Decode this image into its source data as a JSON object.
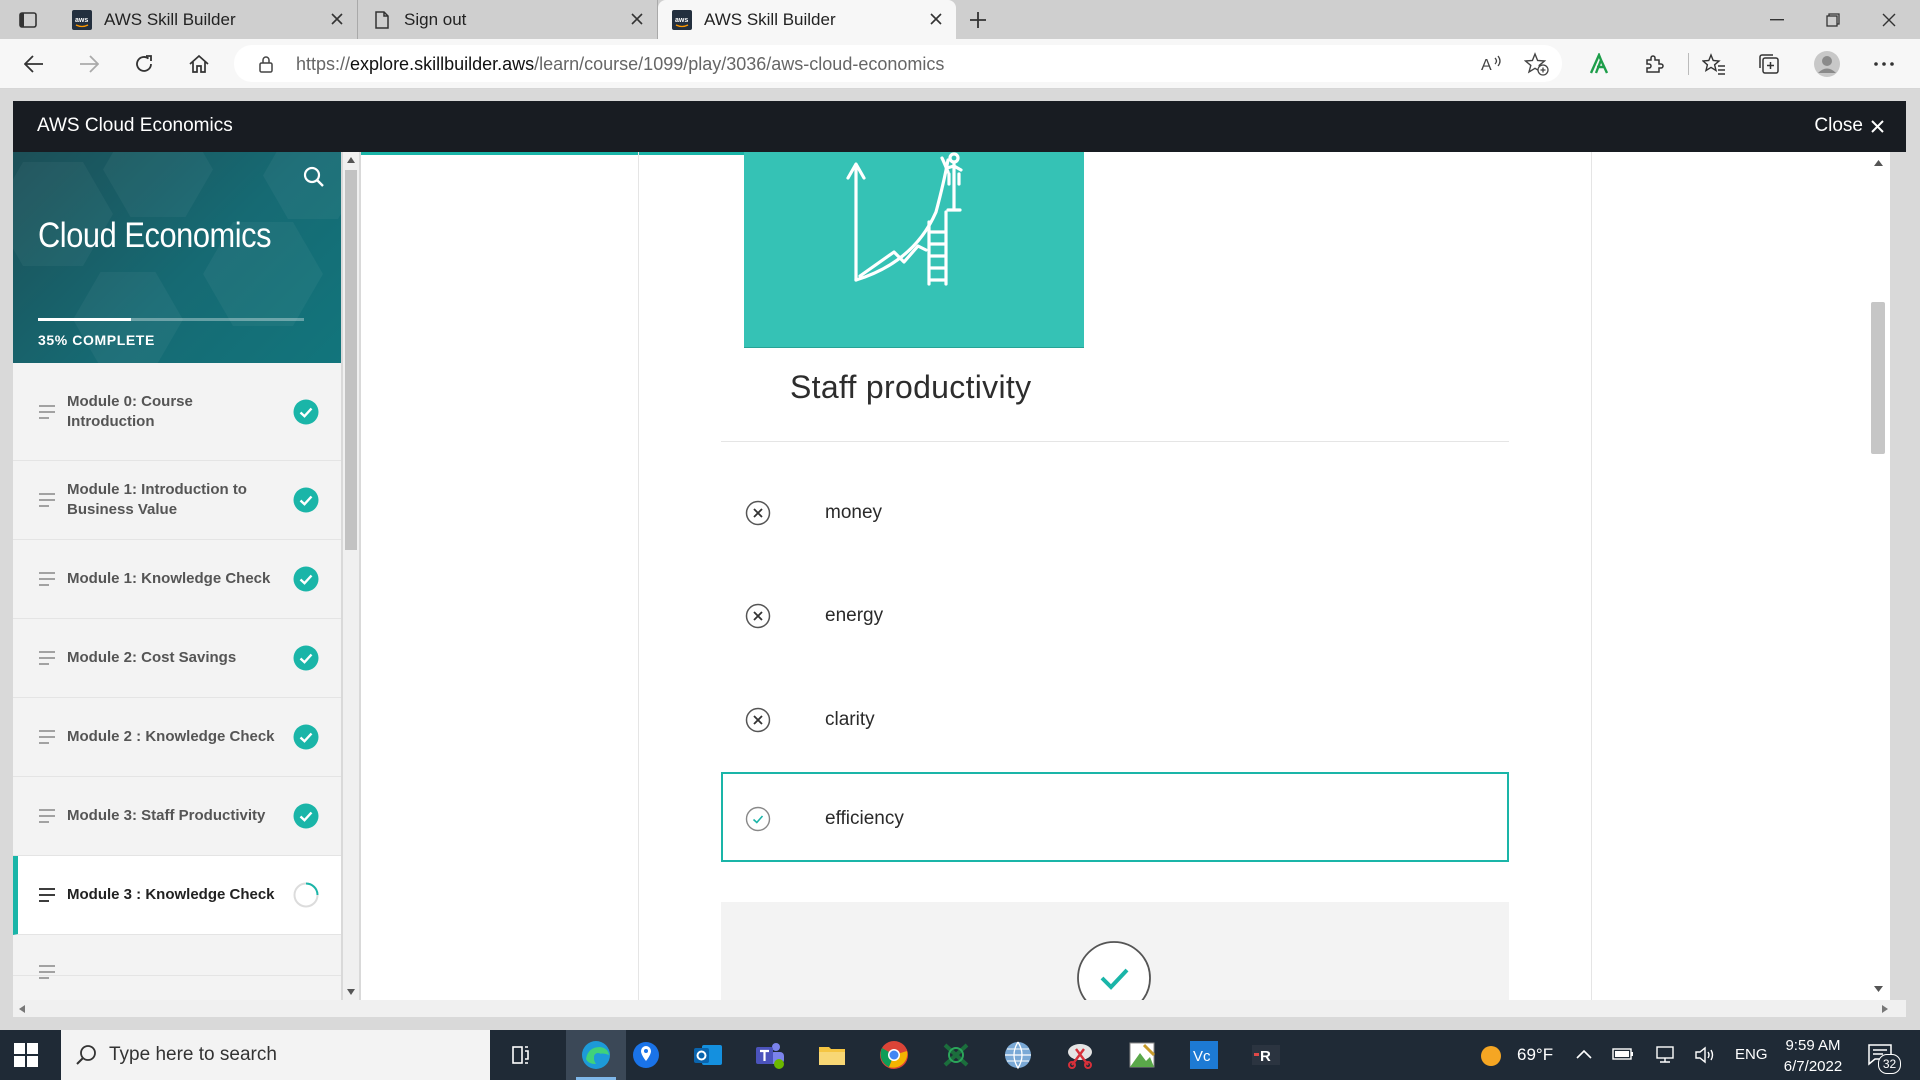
{
  "browser": {
    "tabs": [
      {
        "title": "AWS Skill Builder",
        "active": false
      },
      {
        "title": "Sign out",
        "active": false
      },
      {
        "title": "AWS Skill Builder",
        "active": true
      }
    ],
    "url_prefix": "https://",
    "url_host": "explore.skillbuilder.aws",
    "url_path": "/learn/course/1099/play/3036/aws-cloud-economics"
  },
  "course_bar": {
    "title": "AWS Cloud Economics",
    "close_label": "Close"
  },
  "sidebar": {
    "course_name": "Cloud Economics",
    "progress_fraction": 0.35,
    "progress_label": "35% COMPLETE",
    "modules": [
      {
        "label": "Module 0: Course Introduction",
        "status": "complete"
      },
      {
        "label": "Module 1: Introduction to Business Value",
        "status": "complete"
      },
      {
        "label": "Module 1: Knowledge Check",
        "status": "complete"
      },
      {
        "label": "Module 2: Cost Savings",
        "status": "complete"
      },
      {
        "label": "Module 2 : Knowledge Check",
        "status": "complete"
      },
      {
        "label": "Module 3: Staff Productivity",
        "status": "complete"
      },
      {
        "label": "Module 3 : Knowledge Check",
        "status": "in-progress"
      }
    ]
  },
  "content": {
    "card_label": "Staff productivity",
    "options": [
      {
        "text": "money",
        "result": "incorrect"
      },
      {
        "text": "energy",
        "result": "incorrect"
      },
      {
        "text": "clarity",
        "result": "incorrect"
      },
      {
        "text": "efficiency",
        "result": "correct"
      }
    ]
  },
  "taskbar": {
    "search_placeholder": "Type here to search",
    "weather_temp": "69°F",
    "language": "ENG",
    "time": "9:59 AM",
    "date": "6/7/2022",
    "notification_count": "32"
  },
  "colors": {
    "accent_teal": "#1ab5a8",
    "illustration_bg": "#35c2b5",
    "course_bar_bg": "#181c22",
    "taskbar_bg": "#1f2a36"
  }
}
